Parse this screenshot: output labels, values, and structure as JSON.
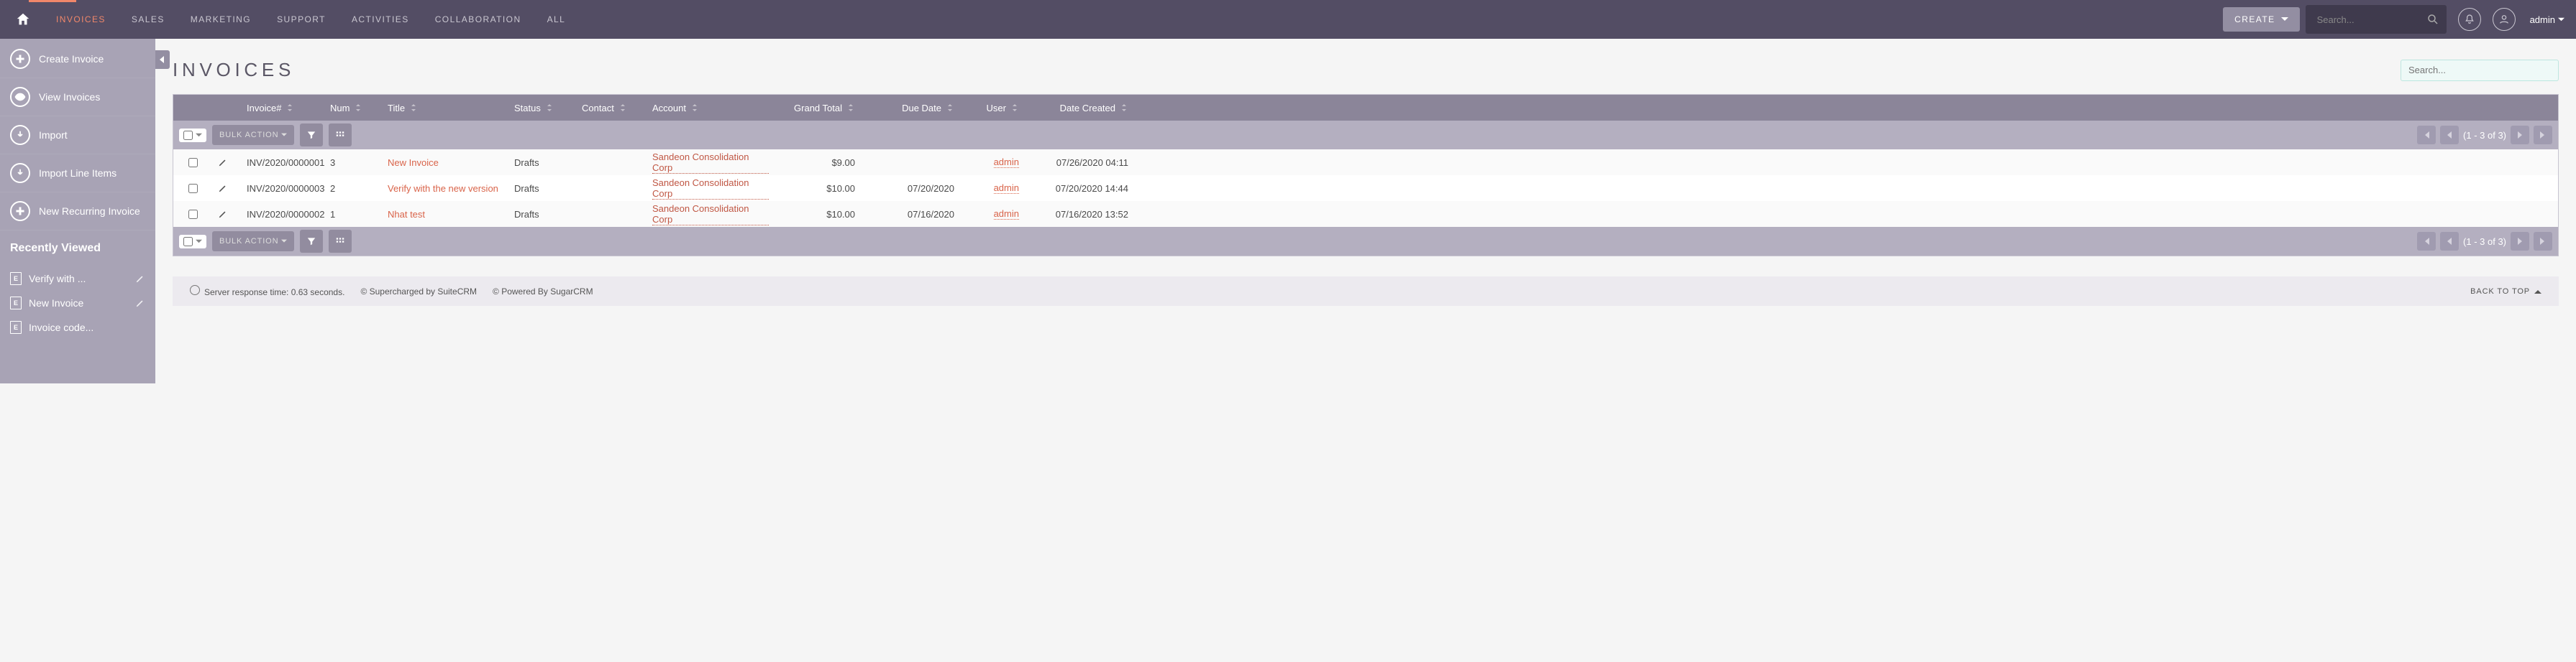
{
  "nav": {
    "items": [
      "INVOICES",
      "SALES",
      "MARKETING",
      "SUPPORT",
      "ACTIVITIES",
      "COLLABORATION",
      "ALL"
    ],
    "active_index": 0,
    "create_label": "CREATE",
    "search_placeholder": "Search...",
    "user_label": "admin"
  },
  "sidebar": {
    "actions": [
      {
        "label": "Create Invoice",
        "icon": "plus"
      },
      {
        "label": "View Invoices",
        "icon": "eye"
      },
      {
        "label": "Import",
        "icon": "download"
      },
      {
        "label": "Import Line Items",
        "icon": "download"
      },
      {
        "label": "New Recurring Invoice",
        "icon": "plus"
      }
    ],
    "recent_heading": "Recently Viewed",
    "recent": [
      {
        "label": "Verify with ..."
      },
      {
        "label": "New Invoice"
      },
      {
        "label": "Invoice code..."
      }
    ]
  },
  "page": {
    "title": "INVOICES",
    "search_placeholder": "Search..."
  },
  "table": {
    "columns": [
      "Invoice#",
      "Num",
      "Title",
      "Status",
      "Contact",
      "Account",
      "Grand Total",
      "Due Date",
      "User",
      "Date Created"
    ],
    "bulk_label": "BULK ACTION",
    "pager_text": "(1 - 3 of 3)",
    "rows": [
      {
        "inv": "INV/2020/0000001",
        "num": "3",
        "title": "New Invoice",
        "status": "Drafts",
        "contact": "",
        "account": "Sandeon Consolidation Corp",
        "total": "$9.00",
        "due": "",
        "user": "admin",
        "date": "07/26/2020 04:11"
      },
      {
        "inv": "INV/2020/0000003",
        "num": "2",
        "title": "Verify with the new version",
        "status": "Drafts",
        "contact": "",
        "account": "Sandeon Consolidation Corp",
        "total": "$10.00",
        "due": "07/20/2020",
        "user": "admin",
        "date": "07/20/2020 14:44"
      },
      {
        "inv": "INV/2020/0000002",
        "num": "1",
        "title": "Nhat test",
        "status": "Drafts",
        "contact": "",
        "account": "Sandeon Consolidation Corp",
        "total": "$10.00",
        "due": "07/16/2020",
        "user": "admin",
        "date": "07/16/2020 13:52"
      }
    ]
  },
  "footer": {
    "response": "Server response time: 0.63 seconds.",
    "supercharged": "© Supercharged by SuiteCRM",
    "powered": "© Powered By SugarCRM",
    "back_top": "BACK TO TOP"
  }
}
